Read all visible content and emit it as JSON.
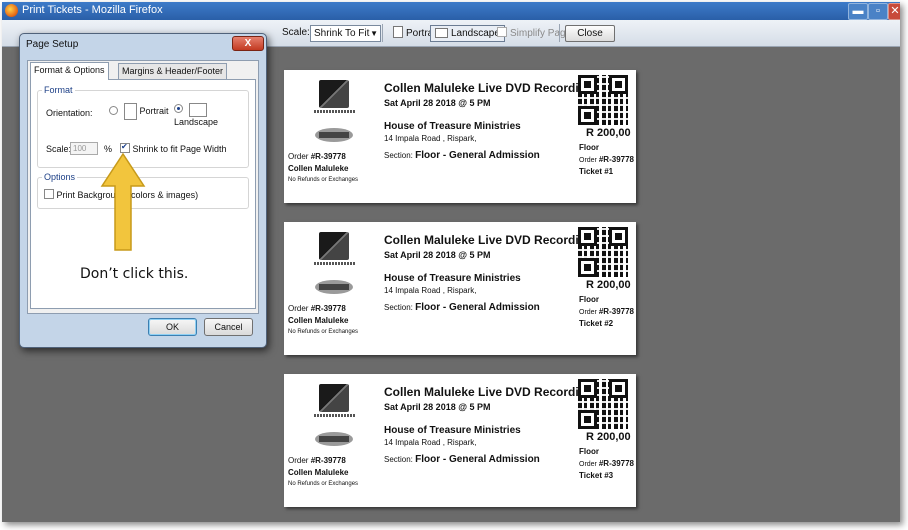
{
  "window": {
    "title": "Print Tickets - Mozilla Firefox",
    "min_label": "▬",
    "max_label": "▫",
    "close_label": "✕"
  },
  "toolbar": {
    "scale_label": "Scale:",
    "scale_value": "Shrink To Fit",
    "portrait_label": "Portrait",
    "landscape_label": "Landscape",
    "simplify_label": "Simplify Page",
    "close_label": "Close"
  },
  "dialog": {
    "title": "Page Setup",
    "close_label": "X",
    "tabs": [
      "Format & Options",
      "Margins & Header/Footer"
    ],
    "format_group": "Format",
    "orientation_label": "Orientation:",
    "portrait": "Portrait",
    "landscape": "Landscape",
    "scale_label": "Scale:",
    "scale_value": "100",
    "percent": "%",
    "shrink_label": "Shrink to fit Page Width",
    "options_group": "Options",
    "print_background_label": "Print Background (colors & images)",
    "ok_label": "OK",
    "cancel_label": "Cancel"
  },
  "annotation": {
    "text": "Don’t click this.",
    "arrow_color": "#f2c53d"
  },
  "tickets": [
    {
      "event": "Collen Maluleke Live DVD Recording",
      "date": "Sat April 28 2018 @ 5 PM",
      "venue": "House of Treasure Ministries",
      "address": "14 Impala Road , Rispark,",
      "section_label": "Section:",
      "section_value": "Floor - General Admission",
      "order_label": "Order",
      "order_no": "#R-39778",
      "buyer": "Collen Maluleke",
      "no_refund": "No Refunds or Exchanges",
      "price": "R 200,00",
      "seat_type": "Floor",
      "ticket_no": "Ticket #1"
    },
    {
      "event": "Collen Maluleke Live DVD Recording",
      "date": "Sat April 28 2018 @ 5 PM",
      "venue": "House of Treasure Ministries",
      "address": "14 Impala Road , Rispark,",
      "section_label": "Section:",
      "section_value": "Floor - General Admission",
      "order_label": "Order",
      "order_no": "#R-39778",
      "buyer": "Collen Maluleke",
      "no_refund": "No Refunds or Exchanges",
      "price": "R 200,00",
      "seat_type": "Floor",
      "ticket_no": "Ticket #2"
    },
    {
      "event": "Collen Maluleke Live DVD Recording",
      "date": "Sat April 28 2018 @ 5 PM",
      "venue": "House of Treasure Ministries",
      "address": "14 Impala Road , Rispark,",
      "section_label": "Section:",
      "section_value": "Floor - General Admission",
      "order_label": "Order",
      "order_no": "#R-39778",
      "buyer": "Collen Maluleke",
      "no_refund": "No Refunds or Exchanges",
      "price": "R 200,00",
      "seat_type": "Floor",
      "ticket_no": "Ticket #3"
    }
  ]
}
